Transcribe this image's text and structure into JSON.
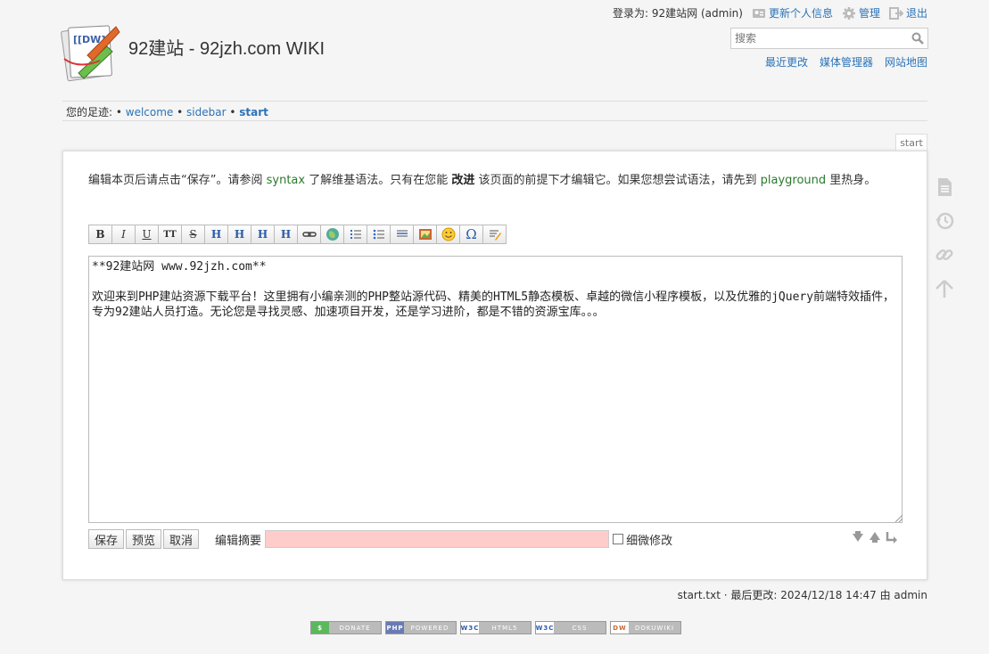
{
  "header": {
    "site_title": "92建站 - 92jzh.com WIKI",
    "logo_text": "[[DW]]",
    "logged_in": "登录为: 92建站网 (admin)",
    "update_profile": "更新个人信息",
    "admin": "管理",
    "logout": "退出",
    "search_placeholder": "搜索",
    "site_tools": [
      "最近更改",
      "媒体管理器",
      "网站地图"
    ]
  },
  "breadcrumbs": {
    "label": "您的足迹:",
    "items": [
      "welcome",
      "sidebar",
      "start"
    ]
  },
  "page_tab": "start",
  "intro": {
    "p1": "编辑本页后请点击“保存”。请参阅 ",
    "syntax": "syntax",
    "p2": " 了解维基语法。只有在您能 ",
    "improve": "改进",
    "p3": " 该页面的前提下才编辑它。如果您想尝试语法，请先到 ",
    "playground": "playground",
    "p4": " 里热身。"
  },
  "toolbar": {
    "bold": "B",
    "italic": "I",
    "underline": "U",
    "mono": "TT",
    "strike": "S",
    "h_same": "H",
    "h_lower": "H",
    "h_higher": "H",
    "h_select": "H",
    "omega": "Ω"
  },
  "editor": {
    "content": "**92建站网 www.92jzh.com**\n\n欢迎来到PHP建站资源下载平台！这里拥有小编亲测的PHP整站源代码、精美的HTML5静态模板、卓越的微信小程序模板，以及优雅的jQuery前端特效插件，专为92建站人员打造。无论您是寻找灵感、加速项目开发，还是学习进阶，都是不错的资源宝库。。。"
  },
  "editbar": {
    "save": "保存",
    "preview": "预览",
    "cancel": "取消",
    "summary_label": "编辑摘要",
    "minor_label": "细微修改"
  },
  "footer": {
    "file": "start.txt",
    "last_modified": " · 最后更改: 2024/12/18 14:47 由 admin"
  },
  "badges": [
    {
      "tag": "$",
      "label": "DONATE",
      "color": "#5cb85c"
    },
    {
      "tag": "PHP",
      "label": "POWERED",
      "color": "#6a7bb4"
    },
    {
      "tag": "W3C",
      "label": "HTML5",
      "color": "#ffffff"
    },
    {
      "tag": "W3C",
      "label": "CSS",
      "color": "#ffffff"
    },
    {
      "tag": "DW",
      "label": "DOKUWIKI",
      "color": "#ffffff"
    }
  ],
  "colors": {
    "link": "#2b73b7",
    "green_link": "#2a7a2a",
    "summary_bg": "#ffcccc"
  }
}
